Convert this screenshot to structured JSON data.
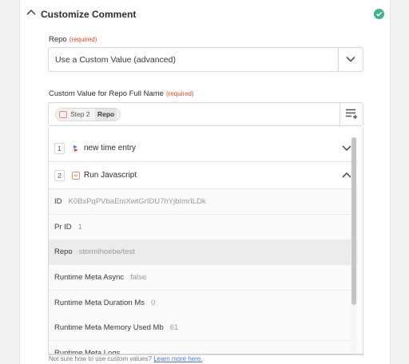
{
  "section": {
    "title": "Customize Comment",
    "status_color": "#3db48a"
  },
  "repo_field": {
    "label": "Repo",
    "required": "(required)",
    "value": "Use a Custom Value (advanced)"
  },
  "custom_value_field": {
    "label": "Custom Value for Repo Full Name",
    "required": "(required)",
    "pill": {
      "step": "Step 2",
      "field": "Repo"
    }
  },
  "steps": [
    {
      "num": "1",
      "label": "new time entry",
      "icon": "time-tracker-app-icon",
      "expanded": false
    },
    {
      "num": "2",
      "label": "Run Javascript",
      "icon": "code-app-icon",
      "expanded": true
    }
  ],
  "data_rows": [
    {
      "key": "ID",
      "value": "K0BxPqPVbaEmXwtGrIDU7hYjbImrILDk"
    },
    {
      "key": "Pr ID",
      "value": "1"
    },
    {
      "key": "Repo",
      "value": "stormihoebe/test"
    },
    {
      "key": "Runtime Meta Async",
      "value": "false"
    },
    {
      "key": "Runtime Meta Duration Ms",
      "value": "0"
    },
    {
      "key": "Runtime Meta Memory Used Mb",
      "value": "61"
    },
    {
      "key": "Runtime Meta Logs",
      "value": ""
    }
  ],
  "help": {
    "text": "Not sure how to use custom values?",
    "link": "Learn more here."
  },
  "colors": {
    "required": "#e04a2a",
    "link": "#4a76c7",
    "accent": "#f08a6a"
  }
}
